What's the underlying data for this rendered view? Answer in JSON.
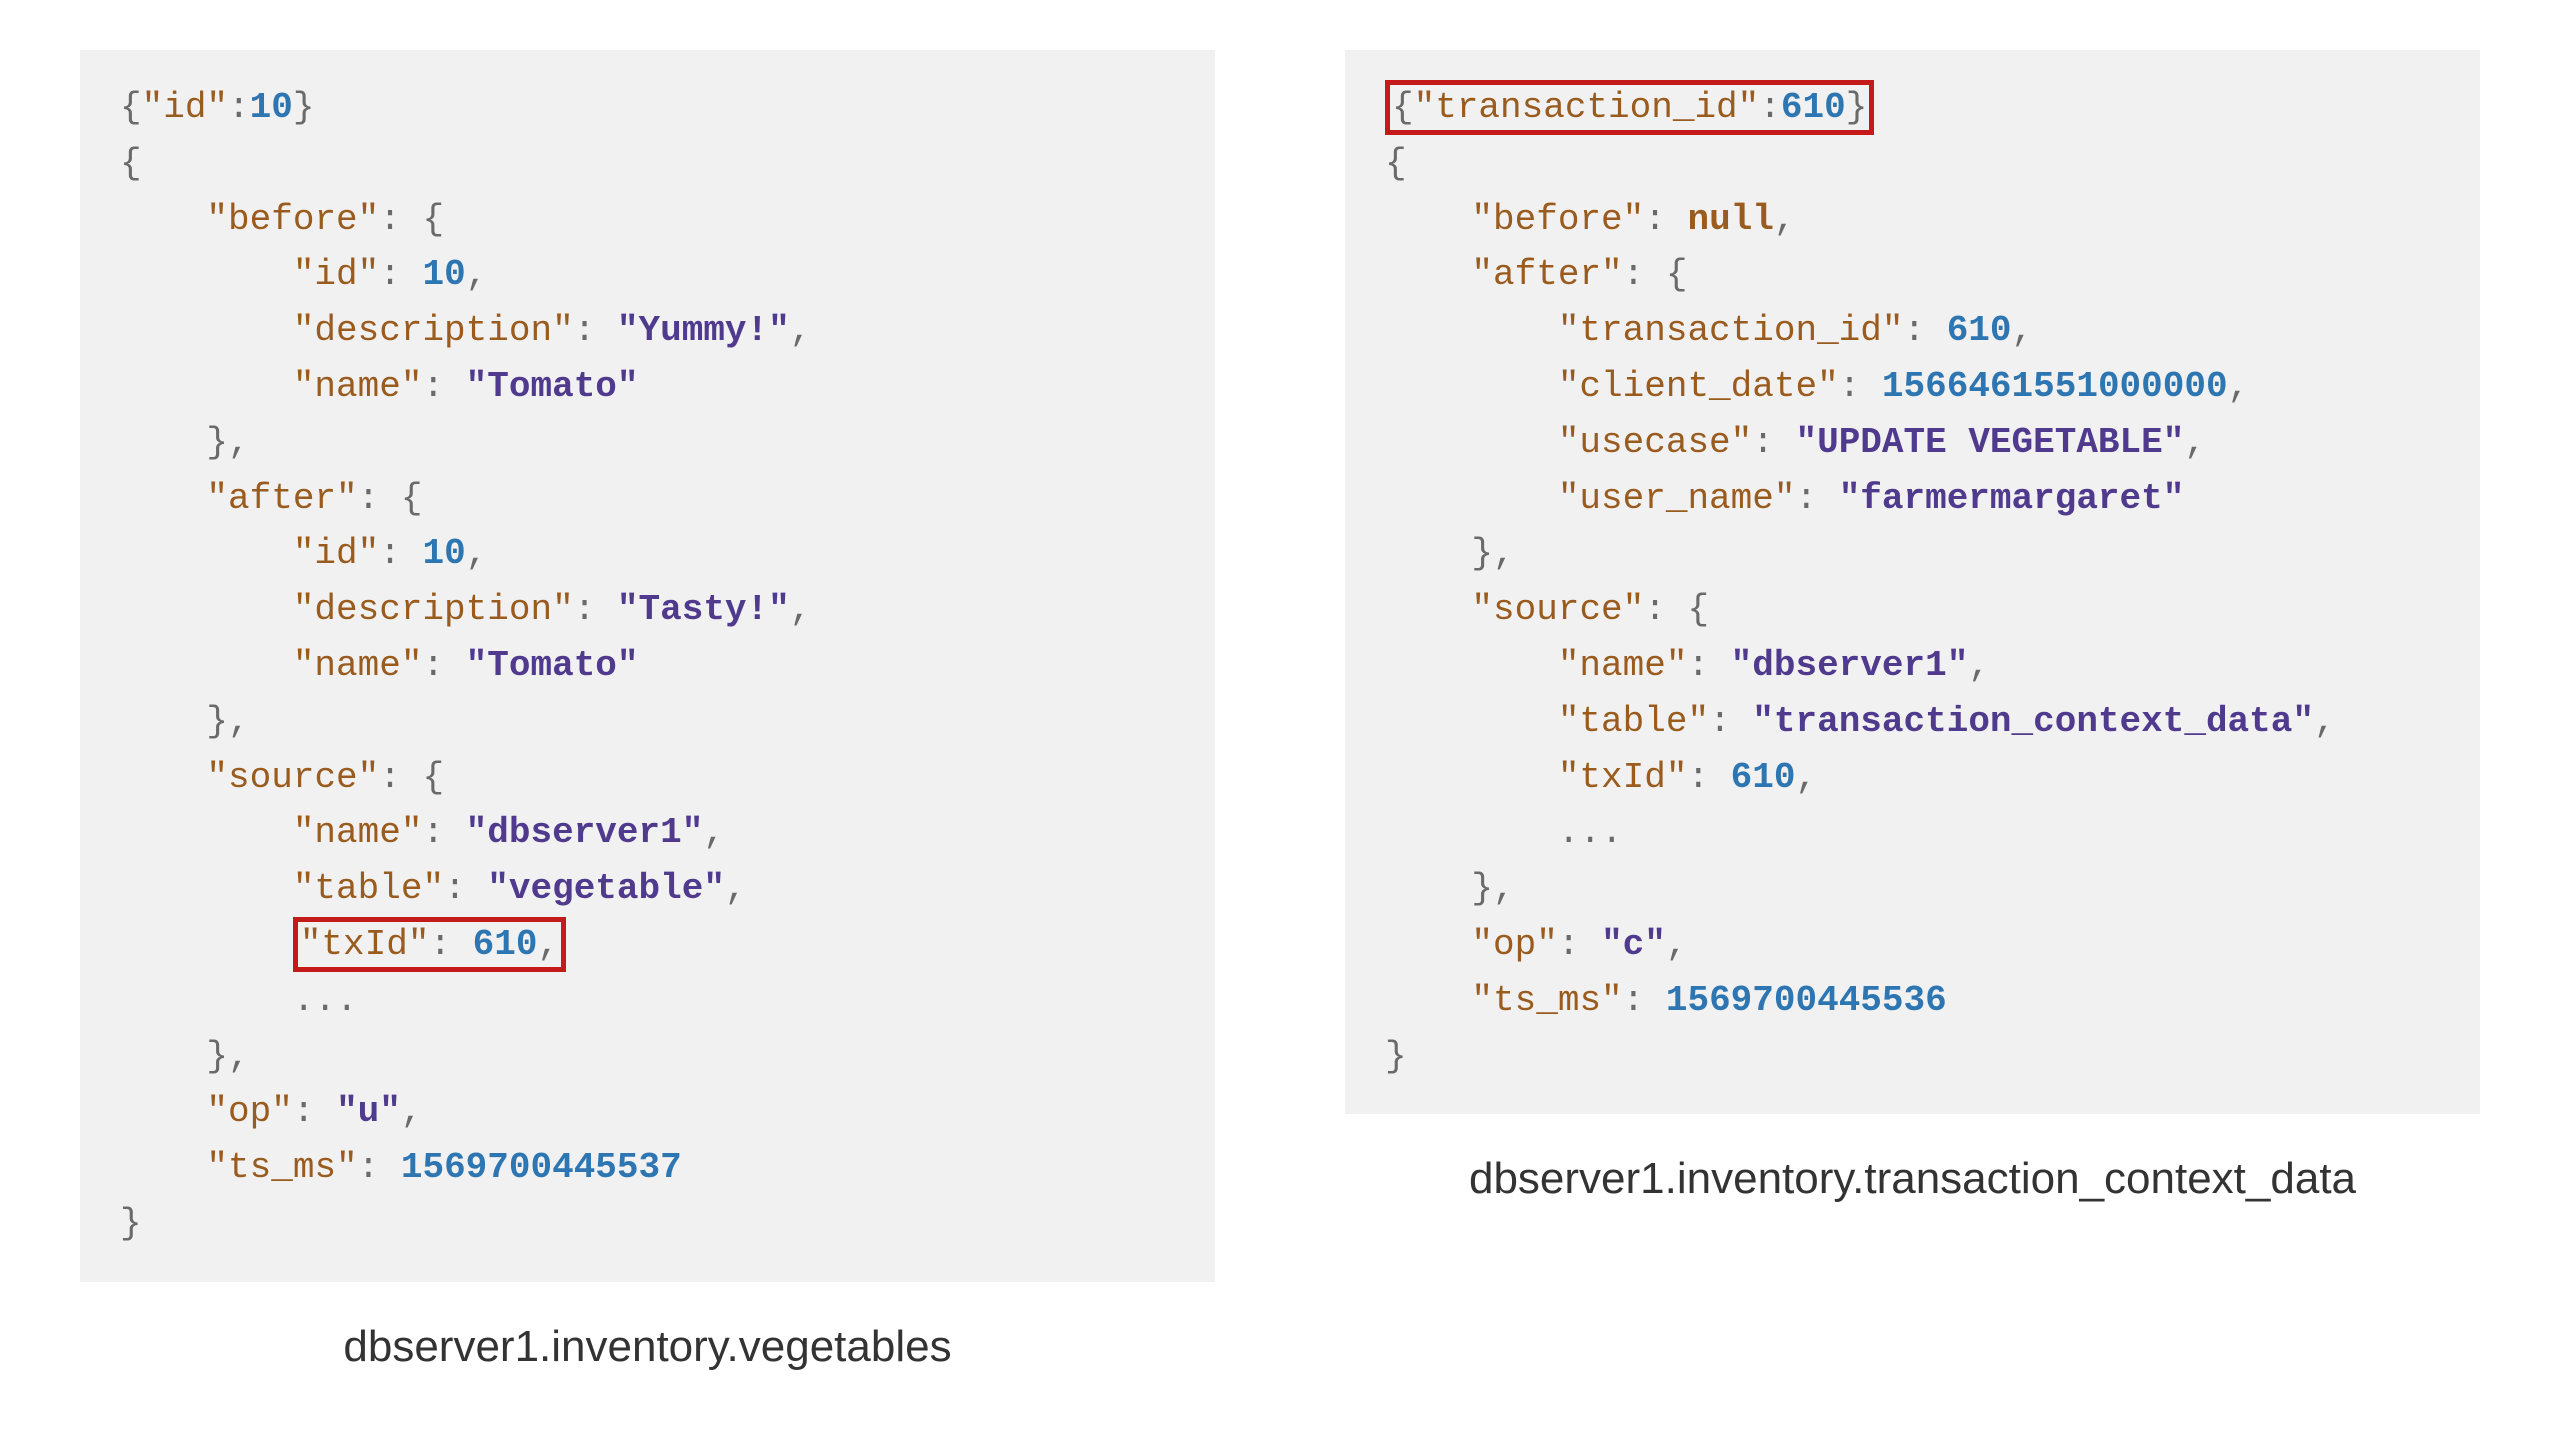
{
  "left": {
    "caption": "dbserver1.inventory.vegetables",
    "tokens": [
      [
        {
          "t": "{",
          "c": "p"
        },
        {
          "t": "\"id\"",
          "c": "k"
        },
        {
          "t": ":",
          "c": "p"
        },
        {
          "t": "10",
          "c": "n"
        },
        {
          "t": "}",
          "c": "p"
        }
      ],
      [
        {
          "t": "{",
          "c": "p"
        }
      ],
      [
        {
          "t": "    ",
          "c": "p"
        },
        {
          "t": "\"before\"",
          "c": "k"
        },
        {
          "t": ": {",
          "c": "p"
        }
      ],
      [
        {
          "t": "        ",
          "c": "p"
        },
        {
          "t": "\"id\"",
          "c": "k"
        },
        {
          "t": ": ",
          "c": "p"
        },
        {
          "t": "10",
          "c": "n"
        },
        {
          "t": ",",
          "c": "p"
        }
      ],
      [
        {
          "t": "        ",
          "c": "p"
        },
        {
          "t": "\"description\"",
          "c": "k"
        },
        {
          "t": ": ",
          "c": "p"
        },
        {
          "t": "\"Yummy!\"",
          "c": "sv"
        },
        {
          "t": ",",
          "c": "p"
        }
      ],
      [
        {
          "t": "        ",
          "c": "p"
        },
        {
          "t": "\"name\"",
          "c": "k"
        },
        {
          "t": ": ",
          "c": "p"
        },
        {
          "t": "\"Tomato\"",
          "c": "sv"
        }
      ],
      [
        {
          "t": "    },",
          "c": "p"
        }
      ],
      [
        {
          "t": "    ",
          "c": "p"
        },
        {
          "t": "\"after\"",
          "c": "k"
        },
        {
          "t": ": {",
          "c": "p"
        }
      ],
      [
        {
          "t": "        ",
          "c": "p"
        },
        {
          "t": "\"id\"",
          "c": "k"
        },
        {
          "t": ": ",
          "c": "p"
        },
        {
          "t": "10",
          "c": "n"
        },
        {
          "t": ",",
          "c": "p"
        }
      ],
      [
        {
          "t": "        ",
          "c": "p"
        },
        {
          "t": "\"description\"",
          "c": "k"
        },
        {
          "t": ": ",
          "c": "p"
        },
        {
          "t": "\"Tasty!\"",
          "c": "sv"
        },
        {
          "t": ",",
          "c": "p"
        }
      ],
      [
        {
          "t": "        ",
          "c": "p"
        },
        {
          "t": "\"name\"",
          "c": "k"
        },
        {
          "t": ": ",
          "c": "p"
        },
        {
          "t": "\"Tomato\"",
          "c": "sv"
        }
      ],
      [
        {
          "t": "    },",
          "c": "p"
        }
      ],
      [
        {
          "t": "    ",
          "c": "p"
        },
        {
          "t": "\"source\"",
          "c": "k"
        },
        {
          "t": ": {",
          "c": "p"
        }
      ],
      [
        {
          "t": "        ",
          "c": "p"
        },
        {
          "t": "\"name\"",
          "c": "k"
        },
        {
          "t": ": ",
          "c": "p"
        },
        {
          "t": "\"dbserver1\"",
          "c": "sv"
        },
        {
          "t": ",",
          "c": "p"
        }
      ],
      [
        {
          "t": "        ",
          "c": "p"
        },
        {
          "t": "\"table\"",
          "c": "k"
        },
        {
          "t": ": ",
          "c": "p"
        },
        {
          "t": "\"vegetable\"",
          "c": "sv"
        },
        {
          "t": ",",
          "c": "p"
        }
      ],
      [
        {
          "t": "        ",
          "c": "p"
        },
        {
          "hl": true,
          "inner": [
            {
              "t": "\"txId\"",
              "c": "k"
            },
            {
              "t": ": ",
              "c": "p"
            },
            {
              "t": "610",
              "c": "n"
            },
            {
              "t": ",",
              "c": "p"
            }
          ]
        }
      ],
      [
        {
          "t": "        ...",
          "c": "p"
        }
      ],
      [
        {
          "t": "    },",
          "c": "p"
        }
      ],
      [
        {
          "t": "    ",
          "c": "p"
        },
        {
          "t": "\"op\"",
          "c": "k"
        },
        {
          "t": ": ",
          "c": "p"
        },
        {
          "t": "\"u\"",
          "c": "sv"
        },
        {
          "t": ",",
          "c": "p"
        }
      ],
      [
        {
          "t": "    ",
          "c": "p"
        },
        {
          "t": "\"ts_ms\"",
          "c": "k"
        },
        {
          "t": ": ",
          "c": "p"
        },
        {
          "t": "1569700445537",
          "c": "n"
        }
      ],
      [
        {
          "t": "}",
          "c": "p"
        }
      ]
    ]
  },
  "right": {
    "caption": "dbserver1.inventory.transaction_context_data",
    "tokens": [
      [
        {
          "hl": true,
          "inner": [
            {
              "t": "{",
              "c": "p"
            },
            {
              "t": "\"transaction_id\"",
              "c": "k"
            },
            {
              "t": ":",
              "c": "p"
            },
            {
              "t": "610",
              "c": "n"
            },
            {
              "t": "}",
              "c": "p"
            }
          ]
        }
      ],
      [
        {
          "t": "{",
          "c": "p"
        }
      ],
      [
        {
          "t": "    ",
          "c": "p"
        },
        {
          "t": "\"before\"",
          "c": "k"
        },
        {
          "t": ": ",
          "c": "p"
        },
        {
          "t": "null",
          "c": "nl"
        },
        {
          "t": ",",
          "c": "p"
        }
      ],
      [
        {
          "t": "    ",
          "c": "p"
        },
        {
          "t": "\"after\"",
          "c": "k"
        },
        {
          "t": ": {",
          "c": "p"
        }
      ],
      [
        {
          "t": "        ",
          "c": "p"
        },
        {
          "t": "\"transaction_id\"",
          "c": "k"
        },
        {
          "t": ": ",
          "c": "p"
        },
        {
          "t": "610",
          "c": "n"
        },
        {
          "t": ",",
          "c": "p"
        }
      ],
      [
        {
          "t": "        ",
          "c": "p"
        },
        {
          "t": "\"client_date\"",
          "c": "k"
        },
        {
          "t": ": ",
          "c": "p"
        },
        {
          "t": "1566461551000000",
          "c": "n"
        },
        {
          "t": ",",
          "c": "p"
        }
      ],
      [
        {
          "t": "        ",
          "c": "p"
        },
        {
          "t": "\"usecase\"",
          "c": "k"
        },
        {
          "t": ": ",
          "c": "p"
        },
        {
          "t": "\"UPDATE VEGETABLE\"",
          "c": "sv"
        },
        {
          "t": ",",
          "c": "p"
        }
      ],
      [
        {
          "t": "        ",
          "c": "p"
        },
        {
          "t": "\"user_name\"",
          "c": "k"
        },
        {
          "t": ": ",
          "c": "p"
        },
        {
          "t": "\"farmermargaret\"",
          "c": "sv"
        }
      ],
      [
        {
          "t": "    },",
          "c": "p"
        }
      ],
      [
        {
          "t": "    ",
          "c": "p"
        },
        {
          "t": "\"source\"",
          "c": "k"
        },
        {
          "t": ": {",
          "c": "p"
        }
      ],
      [
        {
          "t": "        ",
          "c": "p"
        },
        {
          "t": "\"name\"",
          "c": "k"
        },
        {
          "t": ": ",
          "c": "p"
        },
        {
          "t": "\"dbserver1\"",
          "c": "sv"
        },
        {
          "t": ",",
          "c": "p"
        }
      ],
      [
        {
          "t": "        ",
          "c": "p"
        },
        {
          "t": "\"table\"",
          "c": "k"
        },
        {
          "t": ": ",
          "c": "p"
        },
        {
          "t": "\"transaction_context_data\"",
          "c": "sv"
        },
        {
          "t": ",",
          "c": "p"
        }
      ],
      [
        {
          "t": "        ",
          "c": "p"
        },
        {
          "t": "\"txId\"",
          "c": "k"
        },
        {
          "t": ": ",
          "c": "p"
        },
        {
          "t": "610",
          "c": "n"
        },
        {
          "t": ",",
          "c": "p"
        }
      ],
      [
        {
          "t": "        ...",
          "c": "p"
        }
      ],
      [
        {
          "t": "    },",
          "c": "p"
        }
      ],
      [
        {
          "t": "    ",
          "c": "p"
        },
        {
          "t": "\"op\"",
          "c": "k"
        },
        {
          "t": ": ",
          "c": "p"
        },
        {
          "t": "\"c\"",
          "c": "sv"
        },
        {
          "t": ",",
          "c": "p"
        }
      ],
      [
        {
          "t": "    ",
          "c": "p"
        },
        {
          "t": "\"ts_ms\"",
          "c": "k"
        },
        {
          "t": ": ",
          "c": "p"
        },
        {
          "t": "1569700445536",
          "c": "n"
        }
      ],
      [
        {
          "t": "}",
          "c": "p"
        }
      ]
    ]
  }
}
